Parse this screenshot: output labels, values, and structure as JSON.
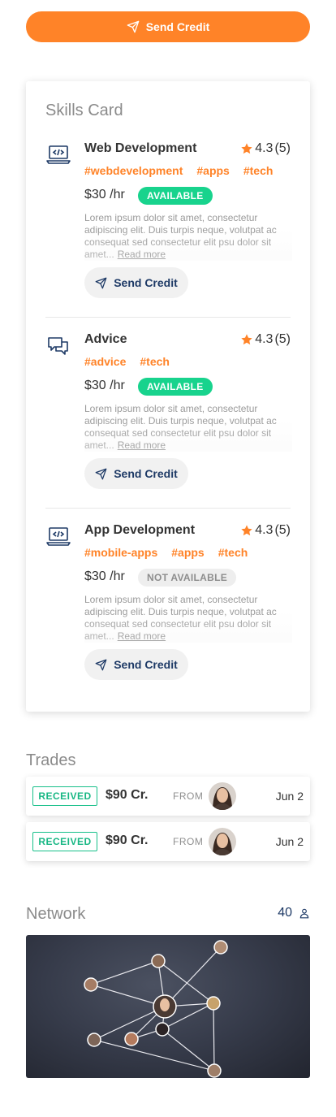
{
  "top_button": {
    "label": "Send Credit"
  },
  "skills_card": {
    "title": "Skills Card",
    "skills": [
      {
        "icon": "laptop-code-icon",
        "name": "Web Development",
        "rating": "4.3",
        "reviews": "(5)",
        "tags": [
          "#webdevelopment",
          "#apps",
          "#tech"
        ],
        "price": "$30 /hr",
        "status": "AVAILABLE",
        "description": "Lorem ipsum dolor sit amet, consectetur adipiscing elit. Duis turpis neque, volutpat ac consequat sed consectetur  elit psu dolor sit amet...",
        "read_more": "Read more",
        "button": "Send Credit"
      },
      {
        "icon": "chat-bubbles-icon",
        "name": "Advice",
        "rating": "4.3",
        "reviews": "(5)",
        "tags": [
          "#advice",
          "#tech"
        ],
        "price": "$30 /hr",
        "status": "AVAILABLE",
        "description": "Lorem ipsum dolor sit amet, consectetur adipiscing elit. Duis turpis neque, volutpat ac consequat sed consectetur  elit psu dolor sit amet...",
        "read_more": "Read more",
        "button": "Send Credit"
      },
      {
        "icon": "laptop-code-icon",
        "name": "App Development",
        "rating": "4.3",
        "reviews": "(5)",
        "tags": [
          "#mobile-apps",
          "#apps",
          "#tech"
        ],
        "price": "$30 /hr",
        "status": "NOT AVAILABLE",
        "description": "Lorem ipsum dolor sit amet, consectetur adipiscing elit. Duis turpis neque, volutpat ac consequat sed consectetur  elit psu dolor sit amet...",
        "read_more": "Read more",
        "button": "Send Credit"
      }
    ]
  },
  "trades": {
    "title": "Trades",
    "items": [
      {
        "status": "RECEIVED",
        "amount": "$90 Cr.",
        "from_label": "FROM",
        "date": "Jun 2"
      },
      {
        "status": "RECEIVED",
        "amount": "$90 Cr.",
        "from_label": "FROM",
        "date": "Jun 2"
      }
    ]
  },
  "network": {
    "title": "Network",
    "count": "40"
  },
  "colors": {
    "accent": "#ff8328",
    "available": "#18d38d",
    "navy": "#1e3a66",
    "received": "#18b784"
  }
}
